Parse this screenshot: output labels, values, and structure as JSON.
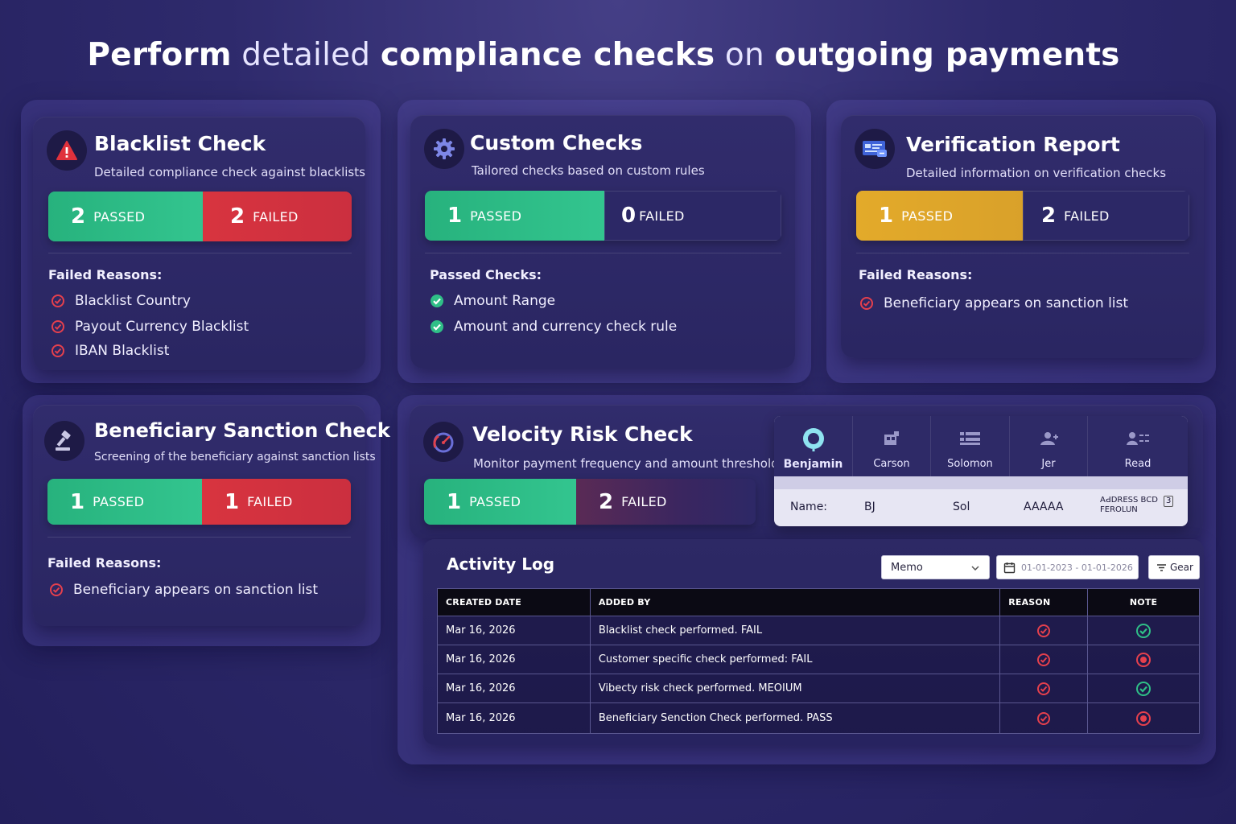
{
  "header": {
    "title_parts": [
      {
        "text": "Perform",
        "strong": true
      },
      {
        "text": " detailed ",
        "strong": false
      },
      {
        "text": "compliance checks",
        "strong": true
      },
      {
        "text": " on ",
        "strong": false
      },
      {
        "text": "outgoing payments",
        "strong": true
      }
    ]
  },
  "colors": {
    "passed": "#2fbf87",
    "failed": "#d6323f",
    "warning": "#e3aa2a",
    "background": "#2e2a6c"
  },
  "cards": {
    "blacklist": {
      "icon": "warning-icon",
      "title": "Blacklist Check",
      "subtitle": "Detailed compliance check against blacklists",
      "passed_count": "2",
      "passed_label": "PASSED",
      "failed_count": "2",
      "failed_label": "FAILED",
      "section_title": "Failed Reasons:",
      "items": [
        "Blacklist Country",
        "Payout Currency Blacklist",
        "IBAN Blacklist"
      ]
    },
    "custom": {
      "icon": "gear-icon",
      "title": "Custom Checks",
      "subtitle": "Tailored checks based on custom rules",
      "passed_count": "1",
      "passed_label": "PASSED",
      "failed_count": "0",
      "failed_label": "FAILED",
      "section_title": "Passed Checks:",
      "items": [
        "Amount Range",
        "Amount and currency check rule"
      ]
    },
    "verification": {
      "icon": "id-card-icon",
      "title": "Verification Report",
      "subtitle": "Detailed information on verification checks",
      "passed_count": "1",
      "passed_label": "PASSED",
      "failed_count": "2",
      "failed_label": "FAILED",
      "section_title": "Failed Reasons:",
      "items": [
        "Beneficiary appears on sanction list"
      ]
    },
    "sanction": {
      "icon": "gavel-icon",
      "title": "Beneficiary Sanction Check",
      "subtitle": "Screening of the beneficiary against sanction lists",
      "passed_count": "1",
      "passed_label": "PASSED",
      "failed_count": "1",
      "failed_label": "FAILED",
      "section_title": "Failed Reasons:",
      "items": [
        "Beneficiary appears on sanction list"
      ]
    },
    "velocity": {
      "icon": "speedometer-icon",
      "title": "Velocity Risk Check",
      "subtitle": "Monitor payment frequency and amount thresholds",
      "passed_count": "1",
      "passed_label": "PASSED",
      "failed_count": "2",
      "failed_label": "FAILED"
    }
  },
  "people": {
    "tabs": [
      {
        "name": "Benjamin",
        "icon": "user-circle-icon",
        "active": true
      },
      {
        "name": "Carson",
        "icon": "building-icon",
        "active": false
      },
      {
        "name": "Solomon",
        "icon": "list-icon",
        "active": false
      },
      {
        "name": "Jer",
        "icon": "user-add-icon",
        "active": false
      },
      {
        "name": "Read",
        "icon": "user-list-icon",
        "active": false
      }
    ],
    "row": {
      "label": "Name:",
      "v1": "BJ",
      "v2": "Sol",
      "v3": "AAAAA",
      "v4_line1": "AԀDRESS BCD",
      "v4_line2": "FEROLUN",
      "v4_badge": "3"
    }
  },
  "activity_log": {
    "title": "Activity Log",
    "filter_value": "Memo",
    "date_range": "01-01-2023 - 01-01-2026",
    "gear_label": "Gear",
    "columns": [
      "CREATED DATE",
      "ADDED BY",
      "REASON",
      "NOTE"
    ],
    "rows": [
      {
        "date": "Mar 16, 2026",
        "added_by": "Blacklist check performed. FAIL",
        "reason": "fail",
        "note": "pass"
      },
      {
        "date": "Mar 16, 2026",
        "added_by": "Customer specific check performed: FAIL",
        "reason": "fail",
        "note": "fail"
      },
      {
        "date": "Mar 16, 2026",
        "added_by": "Vibecty risk check performed. MEOIUM",
        "reason": "fail",
        "note": "pass"
      },
      {
        "date": "Mar 16, 2026",
        "added_by": "Beneficiary Senction Check performed. PASS",
        "reason": "fail",
        "note": "fail"
      }
    ]
  }
}
